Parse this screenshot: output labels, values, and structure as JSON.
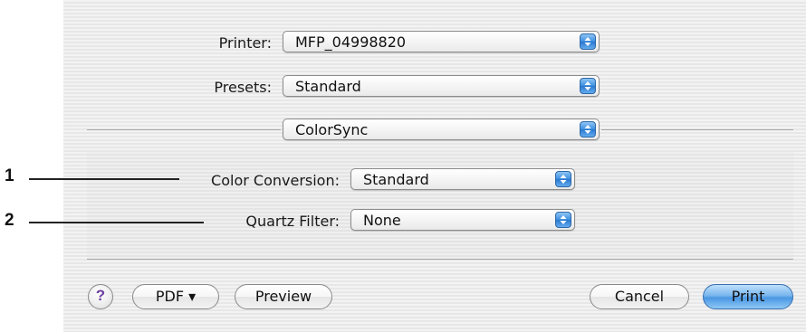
{
  "printer": {
    "label": "Printer:",
    "value": "MFP_04998820"
  },
  "presets": {
    "label": "Presets:",
    "value": "Standard"
  },
  "panel_menu": {
    "value": "ColorSync"
  },
  "color_conversion": {
    "label": "Color Conversion:",
    "value": "Standard"
  },
  "quartz_filter": {
    "label": "Quartz Filter:",
    "value": "None"
  },
  "callouts": [
    "1",
    "2"
  ],
  "buttons": {
    "help": "?",
    "pdf": "PDF ▾",
    "preview": "Preview",
    "cancel": "Cancel",
    "print": "Print"
  },
  "colors": {
    "accent": "#3b8ee0",
    "dialog_bg": "#efefef"
  }
}
